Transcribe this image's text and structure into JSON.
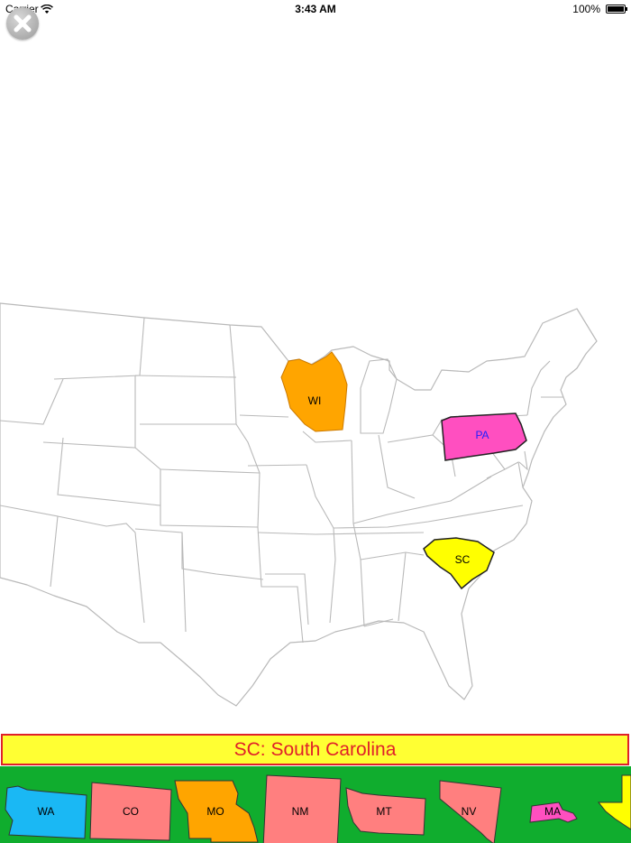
{
  "status_bar": {
    "carrier": "Carrier",
    "time": "3:43 AM",
    "battery": "100%"
  },
  "close_button": {
    "icon": "close-icon"
  },
  "map": {
    "placed_states": [
      {
        "abbr": "WI",
        "color": "#ffa500",
        "label_color": "#000000"
      },
      {
        "abbr": "PA",
        "color": "#ff4fc0",
        "label_color": "#2020ff"
      },
      {
        "abbr": "SC",
        "color": "#ffff00",
        "label_color": "#000000"
      }
    ]
  },
  "prompt": {
    "text": "SC: South Carolina",
    "text_color": "#e0202a",
    "background": "#ffff33"
  },
  "tray": {
    "background": "#10ad2e",
    "pieces": [
      {
        "abbr": "WA",
        "color": "#1ab8f4"
      },
      {
        "abbr": "CO",
        "color": "#ff7f7f"
      },
      {
        "abbr": "MO",
        "color": "#ffa500"
      },
      {
        "abbr": "NM",
        "color": "#ff7f7f"
      },
      {
        "abbr": "MT",
        "color": "#ff7f7f"
      },
      {
        "abbr": "NV",
        "color": "#ff7f7f"
      },
      {
        "abbr": "MA",
        "color": "#ff4fc0"
      },
      {
        "abbr": "",
        "color": "#ffff00"
      }
    ]
  }
}
